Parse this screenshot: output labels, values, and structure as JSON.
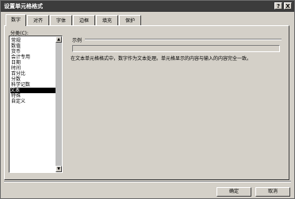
{
  "window": {
    "title": "设置单元格格式",
    "help_glyph": "?",
    "close_glyph": "X"
  },
  "tabs": [
    {
      "label": "数字",
      "active": true
    },
    {
      "label": "对齐",
      "active": false
    },
    {
      "label": "字体",
      "active": false
    },
    {
      "label": "边框",
      "active": false
    },
    {
      "label": "填充",
      "active": false
    },
    {
      "label": "保护",
      "active": false
    }
  ],
  "category": {
    "label": "分类(C):",
    "items": [
      "常规",
      "数值",
      "货币",
      "会计专用",
      "日期",
      "时间",
      "百分比",
      "分数",
      "科学记数",
      "文本",
      "特殊",
      "自定义"
    ],
    "selected_index": 9
  },
  "sample": {
    "label": "示例"
  },
  "description": "在文本单元格格式中，数字作为文本处理。单元格显示的内容与输入的内容完全一致。",
  "buttons": {
    "ok": "确定",
    "cancel": "取消"
  },
  "scrollbar": {
    "up_glyph": "▲",
    "down_glyph": "▼"
  }
}
